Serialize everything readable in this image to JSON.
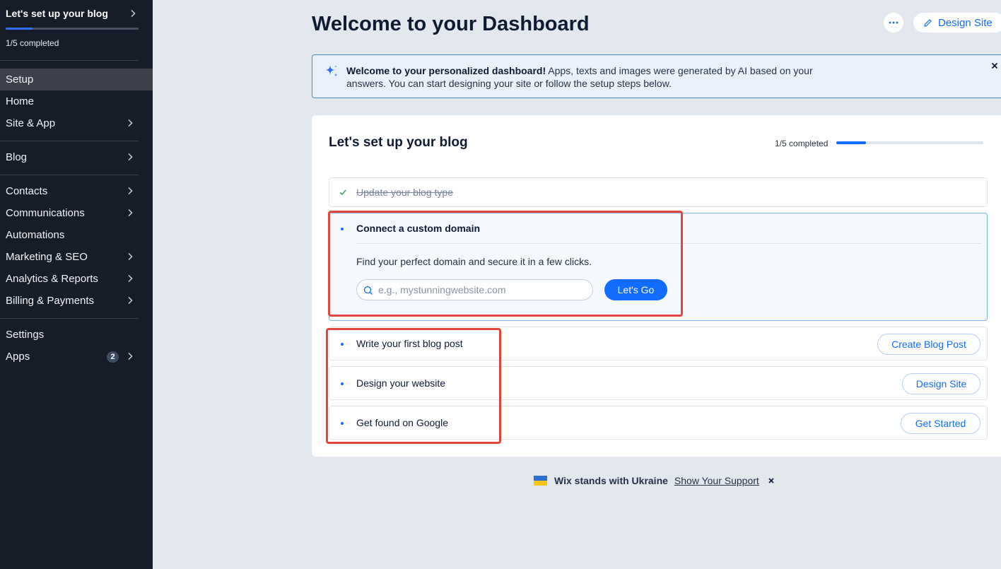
{
  "sidebar": {
    "setup_title": "Let's set up your blog",
    "progress_fraction": 0.2,
    "completed": "1/5 completed",
    "items": [
      {
        "label": "Setup"
      },
      {
        "label": "Home"
      },
      {
        "label": "Site & App"
      },
      {
        "label": "Blog"
      },
      {
        "label": "Contacts"
      },
      {
        "label": "Communications"
      },
      {
        "label": "Automations"
      },
      {
        "label": "Marketing & SEO"
      },
      {
        "label": "Analytics & Reports"
      },
      {
        "label": "Billing & Payments"
      },
      {
        "label": "Settings"
      },
      {
        "label": "Apps",
        "badge": "2"
      }
    ]
  },
  "header": {
    "title": "Welcome to your Dashboard",
    "design_site": "Design Site"
  },
  "banner": {
    "bold": "Welcome to your personalized dashboard!",
    "text": " Apps, texts and images were generated by AI based on your answers. You can start designing your site or follow the setup steps below."
  },
  "setup_card": {
    "title": "Let's set up your blog",
    "completed": "1/5 completed",
    "progress_fraction": 0.2,
    "steps": [
      {
        "label": "Update your blog type",
        "done": true
      },
      {
        "label": "Connect a custom domain",
        "description": "Find your perfect domain and secure it in a few clicks.",
        "placeholder": "e.g., mystunningwebsite.com",
        "button": "Let's Go"
      },
      {
        "label": "Write your first blog post",
        "button": "Create Blog Post"
      },
      {
        "label": "Design your website",
        "button": "Design Site"
      },
      {
        "label": "Get found on Google",
        "button": "Get Started"
      }
    ]
  },
  "footer": {
    "ukraine_text": "Wix stands with Ukraine",
    "support_link": "Show Your Support"
  },
  "colors": {
    "sidebar_bg": "#161c28",
    "accent": "#116dff",
    "highlight_box": "#e0473f"
  },
  "icons": [
    "chevron-right-icon",
    "sparkle-icon",
    "close-icon",
    "pencil-icon",
    "more-icon",
    "check-icon",
    "search-icon",
    "ukraine-flag-icon"
  ]
}
